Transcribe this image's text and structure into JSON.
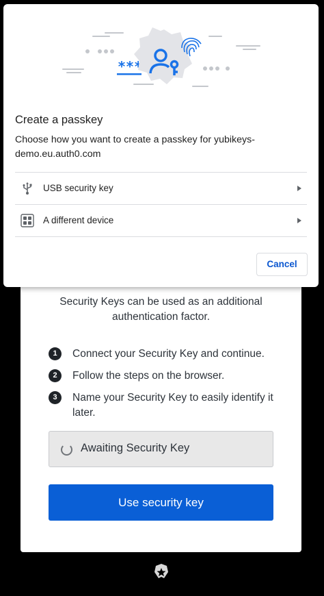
{
  "dialog": {
    "title": "Create a passkey",
    "description": "Choose how you want to create a passkey for yubikeys-demo.eu.auth0.com",
    "options": [
      {
        "label": "USB security key",
        "icon": "usb-icon"
      },
      {
        "label": "A different device",
        "icon": "qr-code-icon"
      }
    ],
    "cancel_label": "Cancel",
    "illustration": {
      "password_mask": "***",
      "icon": "passkey-user-key-icon"
    }
  },
  "auth_card": {
    "intro": "Security Keys can be used as an additional authentication factor.",
    "steps": [
      {
        "number": "1",
        "text": "Connect your Security Key and continue."
      },
      {
        "number": "2",
        "text": "Follow the steps on the browser."
      },
      {
        "number": "3",
        "text": "Name your Security Key to easily identify it later."
      }
    ],
    "awaiting_label": "Awaiting Security Key",
    "use_key_label": "Use security key"
  },
  "footer": {
    "logo": "auth0-logo"
  },
  "colors": {
    "primary_button": "#0a5fd6",
    "dialog_link": "#0b57d0",
    "illustration_blue": "#1a73e8",
    "illustration_badge": "#e3e4e8"
  }
}
